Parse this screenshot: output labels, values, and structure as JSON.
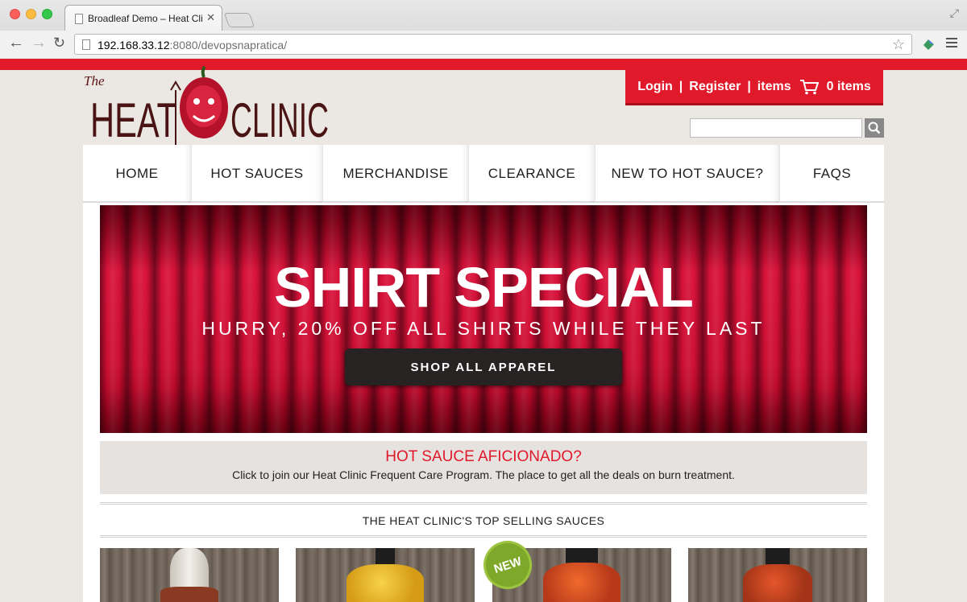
{
  "browser": {
    "tab_title": "Broadleaf Demo – Heat Cli",
    "url_host": "192.168.33.12",
    "url_rest": ":8080/devopsnapratica/"
  },
  "header": {
    "logo_small": "The",
    "logo_left": "HEAT",
    "logo_right": "CLINIC",
    "login": "Login",
    "register": "Register",
    "items_label": "items",
    "cart_count": "0 items",
    "separator": "|",
    "search_placeholder": ""
  },
  "nav": {
    "items": [
      {
        "label": "HOME"
      },
      {
        "label": "HOT SAUCES"
      },
      {
        "label": "MERCHANDISE"
      },
      {
        "label": "CLEARANCE"
      },
      {
        "label": "NEW TO HOT SAUCE?"
      },
      {
        "label": "FAQS"
      }
    ]
  },
  "banner": {
    "title": "SHIRT SPECIAL",
    "subtitle": "HURRY, 20% OFF ALL SHIRTS WHILE THEY LAST",
    "button": "SHOP ALL APPAREL"
  },
  "promo": {
    "title": "HOT SAUCE AFICIONADO?",
    "text": "Click to join our Heat Clinic Frequent Care Program. The place to get all the deals on burn treatment."
  },
  "top_selling": {
    "heading": "THE HEAT CLINIC'S TOP SELLING SAUCES",
    "badge": "NEW"
  },
  "colors": {
    "brand_red": "#e0192b",
    "promo_bg": "#e6e2df",
    "badge_green": "#7ea82a"
  }
}
